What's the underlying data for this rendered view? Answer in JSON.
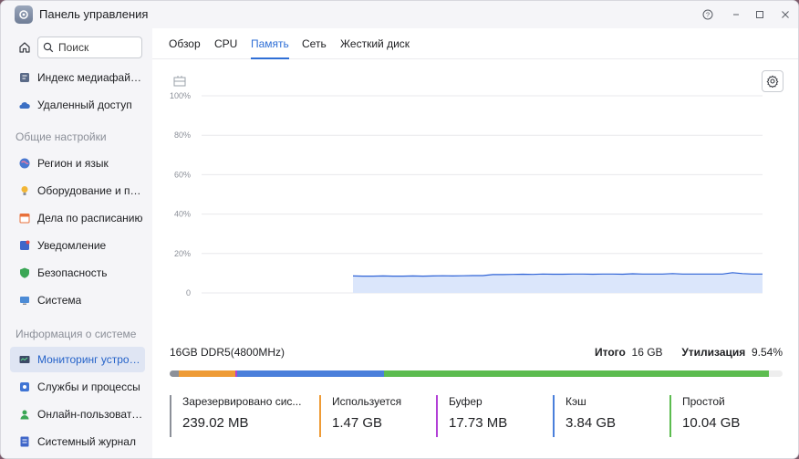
{
  "window": {
    "title": "Панель управления"
  },
  "sidebar": {
    "search": {
      "placeholder": "Поиск"
    },
    "items_top": [
      {
        "label": "Индекс медиафайлов",
        "icon": "media-index-icon",
        "color": "#5b6b88"
      },
      {
        "label": "Удаленный доступ",
        "icon": "cloud-icon",
        "color": "#3b6fc4"
      }
    ],
    "section_general": "Общие настройки",
    "items_general": [
      {
        "label": "Регион и язык",
        "icon": "globe-icon",
        "color": "#4a78d0"
      },
      {
        "label": "Оборудование и пит...",
        "icon": "bulb-icon",
        "color": "#f2b636"
      },
      {
        "label": "Дела по расписанию",
        "icon": "calendar-icon",
        "color": "#e8703a"
      },
      {
        "label": "Уведомление",
        "icon": "notification-icon",
        "color": "#3f66c9"
      },
      {
        "label": "Безопасность",
        "icon": "shield-icon",
        "color": "#3aa655"
      },
      {
        "label": "Система",
        "icon": "system-icon",
        "color": "#4c8bd6"
      }
    ],
    "section_info": "Информация о системе",
    "items_info": [
      {
        "label": "Мониторинг устройс...",
        "icon": "monitor-icon",
        "color": "#3d4a66",
        "active": true
      },
      {
        "label": "Службы и процессы",
        "icon": "services-icon",
        "color": "#3f74d4"
      },
      {
        "label": "Онлайн-пользователи",
        "icon": "users-icon",
        "color": "#3aa655"
      },
      {
        "label": "Системный журнал",
        "icon": "log-icon",
        "color": "#3f66c9"
      }
    ]
  },
  "tabs": [
    {
      "label": "Обзор",
      "active": false
    },
    {
      "label": "CPU",
      "active": false
    },
    {
      "label": "Память",
      "active": true
    },
    {
      "label": "Сеть",
      "active": false
    },
    {
      "label": "Жесткий диск",
      "active": false
    }
  ],
  "chart_data": {
    "type": "area",
    "title": "",
    "xlabel": "",
    "ylabel": "",
    "yticks": [
      "100%",
      "80%",
      "60%",
      "40%",
      "20%",
      "0"
    ],
    "ylim": [
      0,
      100
    ],
    "grid": true,
    "series": [
      {
        "values": [
          8.6,
          8.5,
          8.5,
          8.6,
          8.5,
          8.5,
          8.6,
          8.5,
          8.6,
          8.7,
          8.6,
          8.7,
          8.8,
          8.8,
          9.3,
          9.3,
          9.4,
          9.5,
          9.4,
          9.6,
          9.5,
          9.5,
          9.6,
          9.6,
          9.5,
          9.6,
          9.6,
          9.5,
          9.7,
          9.6,
          9.6,
          9.6,
          9.8,
          9.6,
          9.6,
          9.6,
          9.6,
          9.6,
          10.3,
          9.8,
          9.6,
          9.6
        ]
      }
    ],
    "colors": {
      "line": "#2f63d6",
      "fill": "#dbe6fb",
      "grid": "#e8e8ec"
    }
  },
  "memory": {
    "type": "16GB DDR5(4800MHz)",
    "total_label": "Итого",
    "total_value": "16 GB",
    "util_label": "Утилизация",
    "util_value": "9.54%"
  },
  "usage_segments": [
    {
      "name": "Зарезервировано сис...",
      "value": "239.02 MB",
      "fraction": 0.0146,
      "color": "#8c9099"
    },
    {
      "name": "Используется",
      "value": "1.47 GB",
      "fraction": 0.0919,
      "color": "#ee9b36"
    },
    {
      "name": "Буфер",
      "value": "17.73 MB",
      "fraction": 0.0011,
      "color": "#b23fd6"
    },
    {
      "name": "Кэш",
      "value": "3.84 GB",
      "fraction": 0.24,
      "color": "#4a7fdb"
    },
    {
      "name": "Простой",
      "value": "10.04 GB",
      "fraction": 0.6275,
      "color": "#5cbc4f"
    }
  ]
}
